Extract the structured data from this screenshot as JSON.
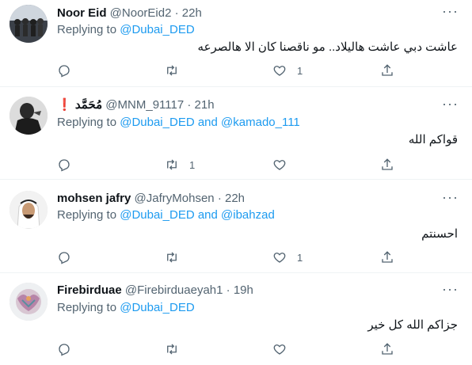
{
  "tweets": [
    {
      "name": "Noor Eid",
      "handle": "@NoorEid2",
      "time": "22h",
      "replying_prefix": "Replying to",
      "mention1": "@Dubai_DED",
      "and": "",
      "mention2": "",
      "text": "عاشت دبي عاشت هاليلاد.. مو ناقصنا كان الا هالصرعه",
      "replies": "",
      "retweets": "",
      "likes": "1"
    },
    {
      "name": "❗ مُحَمَّد",
      "handle": "@MNM_91117",
      "time": "21h",
      "replying_prefix": "Replying to",
      "mention1": "@Dubai_DED",
      "and": "and",
      "mention2": "@kamado_111",
      "text": "قواكم الله",
      "replies": "",
      "retweets": "1",
      "likes": ""
    },
    {
      "name": "mohsen jafry",
      "handle": "@JafryMohsen",
      "time": "22h",
      "replying_prefix": "Replying to",
      "mention1": "@Dubai_DED",
      "and": "and",
      "mention2": "@ibahzad",
      "text": "احسنتم",
      "replies": "",
      "retweets": "",
      "likes": "1"
    },
    {
      "name": "Firebirduae",
      "handle": "@Firebirduaeyah1",
      "time": "19h",
      "replying_prefix": "Replying to",
      "mention1": "@Dubai_DED",
      "and": "",
      "mention2": "",
      "text": "جزاكم الله كل خير",
      "replies": "",
      "retweets": "",
      "likes": ""
    }
  ],
  "separator": "·",
  "icons": {
    "more": "more-dots-icon",
    "reply": "reply-icon",
    "retweet": "retweet-icon",
    "like": "heart-icon",
    "share": "share-icon"
  },
  "colors": {
    "link": "#1d9bf0",
    "muted": "#536471",
    "text": "#0f1419"
  }
}
